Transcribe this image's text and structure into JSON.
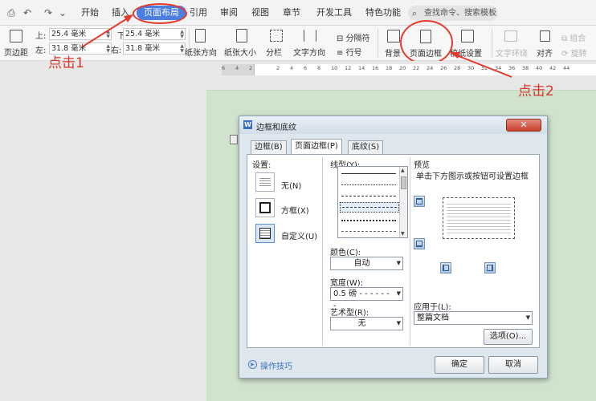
{
  "menubar": {
    "tabs": [
      "开始",
      "插入",
      "页面布局",
      "引用",
      "审阅",
      "视图",
      "章节",
      "开发工具",
      "特色功能"
    ],
    "active_tab": "页面布局",
    "search_placeholder": "查找命令、搜索模板"
  },
  "ribbon": {
    "margins_label": "页边距",
    "top_label": "上:",
    "top_value": "25.4 毫米",
    "bottom_label": "下:",
    "bottom_value": "25.4 毫米",
    "left_label": "左:",
    "left_value": "31.8 毫米",
    "right_label": "右:",
    "right_value": "31.8 毫米",
    "orientation": "纸张方向",
    "size": "纸张大小",
    "columns": "分栏",
    "text_direction": "文字方向",
    "separator": "分隔符",
    "line_numbers": "行号",
    "background": "背景",
    "page_border": "页面边框",
    "paper_setup": "稿纸设置",
    "text_wrap": "文字环绕",
    "align": "对齐",
    "group": "组合",
    "rotate": "旋转"
  },
  "ruler": {
    "ticks": [
      "6",
      "4",
      "2",
      "",
      "2",
      "4",
      "6",
      "8",
      "10",
      "12",
      "14",
      "16",
      "18",
      "20",
      "22",
      "24",
      "26",
      "28",
      "30",
      "32",
      "34",
      "36",
      "38",
      "40",
      "42",
      "44"
    ]
  },
  "annotations": {
    "click1": "点击1",
    "click2": "点击2"
  },
  "dialog": {
    "title": "边框和底纹",
    "tabs": [
      "边框(B)",
      "页面边框(P)",
      "底纹(S)"
    ],
    "active_tab": "页面边框(P)",
    "settings_label": "设置:",
    "settings": [
      "无(N)",
      "方框(X)",
      "自定义(U)"
    ],
    "line_style_label": "线型(Y):",
    "color_label": "颜色(C):",
    "color_value": "自动",
    "width_label": "宽度(W):",
    "width_value": "0.5  磅 - - - - - - -",
    "art_label": "艺术型(R):",
    "art_value": "无",
    "preview_label": "预览",
    "preview_hint": "单击下方图示或按钮可设置边框",
    "apply_label": "应用于(L):",
    "apply_value": "整篇文档",
    "options_button": "选项(O)...",
    "tips": "操作技巧",
    "ok": "确定",
    "cancel": "取消"
  }
}
